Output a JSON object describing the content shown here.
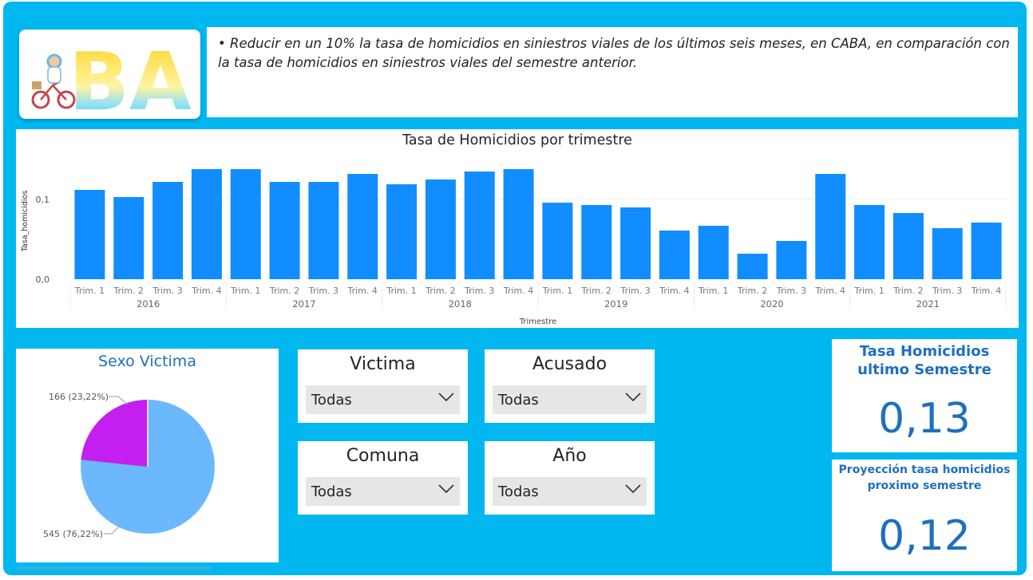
{
  "header": {
    "logo_text": "BA",
    "objective_bullet": "•",
    "objective_text": "Reducir en un 10% la tasa de homicidios en siniestros viales de los últimos seis meses, en CABA, en comparación con la tasa de homicidios en siniestros viales del semestre anterior."
  },
  "colors": {
    "background": "#00b7ef",
    "bar": "#118dff",
    "pie_main": "#6cb8ff",
    "pie_minor": "#c31ff0",
    "accent_text": "#1f6fbf"
  },
  "chart_data": {
    "type": "bar",
    "title": "Tasa de Homicidios por trimestre",
    "xlabel": "Trimestre",
    "ylabel": "Tasa_homicidios",
    "ylim": [
      0,
      0.14
    ],
    "y_ticks": [
      "0,0",
      "0,1"
    ],
    "years": [
      "2016",
      "2017",
      "2018",
      "2019",
      "2020",
      "2021"
    ],
    "quarters": [
      "Trim. 1",
      "Trim. 2",
      "Trim. 3",
      "Trim. 4"
    ],
    "values": [
      0.112,
      0.103,
      0.122,
      0.138,
      0.138,
      0.122,
      0.122,
      0.132,
      0.119,
      0.125,
      0.135,
      0.138,
      0.096,
      0.093,
      0.09,
      0.061,
      0.067,
      0.032,
      0.048,
      0.132,
      0.093,
      0.083,
      0.064,
      0.071
    ],
    "grid": true
  },
  "pie": {
    "title": "Sexo Victima",
    "slices": [
      {
        "label": "166 (23,22%)",
        "value": 166,
        "percent": 23.22
      },
      {
        "label": "545 (76,22%)",
        "value": 545,
        "percent": 76.22
      }
    ]
  },
  "slicers": [
    {
      "title": "Victima",
      "value": "Todas"
    },
    {
      "title": "Acusado",
      "value": "Todas"
    },
    {
      "title": "Comuna",
      "value": "Todas"
    },
    {
      "title": "Año",
      "value": "Todas"
    }
  ],
  "cards": {
    "last_semester": {
      "title": "Tasa Homicidios ultimo Semestre",
      "value": "0,13"
    },
    "projection": {
      "title": "Proyección tasa homicidios proximo semestre",
      "value": "0,12"
    }
  }
}
